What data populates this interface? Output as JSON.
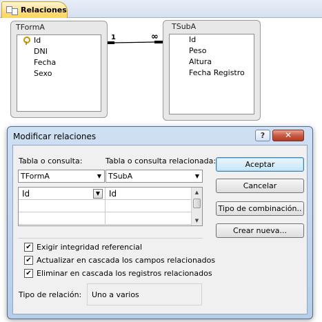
{
  "tab": {
    "label": "Relaciones",
    "icon": "relationships-icon"
  },
  "tables": [
    {
      "name": "TFormA",
      "fields": [
        "Id",
        "DNI",
        "Fecha",
        "Sexo"
      ],
      "primary_key": "Id"
    },
    {
      "name": "TSubA",
      "fields": [
        "Id",
        "Peso",
        "Altura",
        "Fecha Registro"
      ]
    }
  ],
  "relationship": {
    "one_label": "1",
    "many_label": "∞"
  },
  "dialog": {
    "title": "Modificar relaciones",
    "help_label": "?",
    "close_label": "✕",
    "table_label": "Tabla o consulta:",
    "related_table_label": "Tabla o consulta relacionada:",
    "table_value": "TFormA",
    "related_table_value": "TSubA",
    "grid_rows": [
      {
        "left": "Id",
        "right": "Id"
      },
      {
        "left": "",
        "right": ""
      },
      {
        "left": "",
        "right": ""
      }
    ],
    "checks": [
      {
        "label": "Exigir integridad referencial",
        "checked": true
      },
      {
        "label": "Actualizar en cascada los campos relacionados",
        "checked": true
      },
      {
        "label": "Eliminar en cascada los registros relacionados",
        "checked": true
      }
    ],
    "relation_type_label": "Tipo de relación:",
    "relation_type_value": "Uno a varios",
    "buttons": {
      "accept": "Aceptar",
      "cancel": "Cancelar",
      "join_type": "Tipo de combinación..",
      "create_new": "Crear nueva..."
    }
  }
}
